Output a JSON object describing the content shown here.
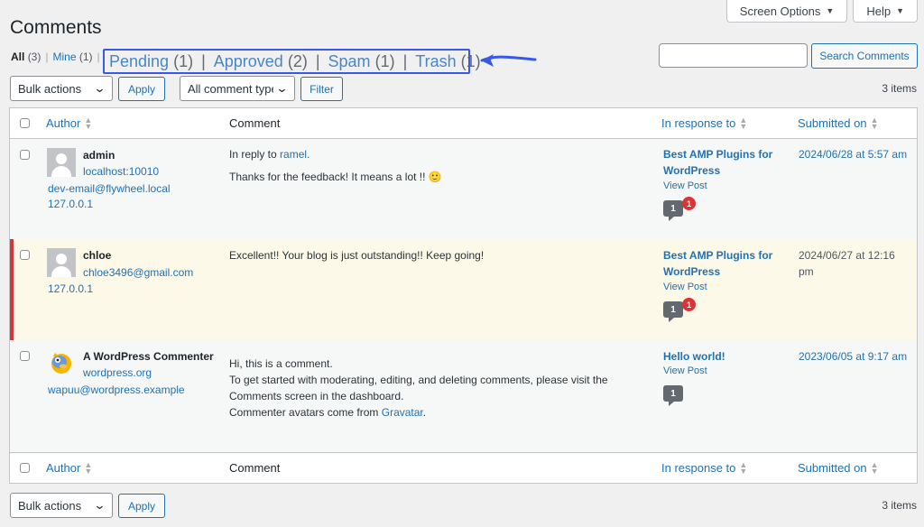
{
  "top": {
    "screen_options": "Screen Options",
    "help": "Help"
  },
  "title": "Comments",
  "views": {
    "all": "All",
    "all_count": "(3)",
    "mine": "Mine",
    "mine_count": "(1)",
    "pending": "Pending",
    "pending_count": "(1)",
    "approved": "Approved",
    "approved_count": "(2)",
    "spam": "Spam",
    "spam_count": "(1)",
    "trash": "Trash",
    "trash_count": "(1)"
  },
  "search": {
    "button": "Search Comments",
    "value": ""
  },
  "toolbar": {
    "bulk_actions": "Bulk actions",
    "apply": "Apply",
    "comment_type": "All comment types",
    "filter": "Filter",
    "items": "3 items"
  },
  "columns": {
    "author": "Author",
    "comment": "Comment",
    "response": "In response to",
    "submitted": "Submitted on"
  },
  "rows": [
    {
      "author": "admin",
      "site": "localhost:10010",
      "email": "dev-email@flywheel.local",
      "ip": "127.0.0.1",
      "reply_prefix": "In reply to",
      "reply_to": "ramel.",
      "text": "Thanks for the feedback! It means a lot !! 🙂",
      "post": "Best AMP Plugins for WordPress",
      "view_post": "View Post",
      "approved_count": "1",
      "pending_count": "1",
      "date": "2024/06/28 at 5:57 am"
    },
    {
      "author": "chloe",
      "email": "chloe3496@gmail.com",
      "ip": "127.0.0.1",
      "text": "Excellent!! Your blog is just outstanding!! Keep going!",
      "post": "Best AMP Plugins for WordPress",
      "view_post": "View Post",
      "approved_count": "1",
      "pending_count": "1",
      "date": "2024/06/27 at 12:16 pm"
    },
    {
      "author": "A WordPress Commenter",
      "site": "wordpress.org",
      "email": "wapuu@wordpress.example",
      "text_lines": [
        "Hi, this is a comment.",
        "To get started with moderating, editing, and deleting comments, please visit the",
        "Comments screen in the dashboard."
      ],
      "text_last_prefix": "Commenter avatars come from",
      "text_last_link": "Gravatar",
      "post": "Hello world!",
      "view_post": "View Post",
      "approved_count": "1",
      "date": "2023/06/05 at 9:17 am"
    }
  ],
  "colors": {
    "accent": "#2271b1",
    "highlight_box": "#3858e9",
    "pending_border": "#d63638"
  }
}
